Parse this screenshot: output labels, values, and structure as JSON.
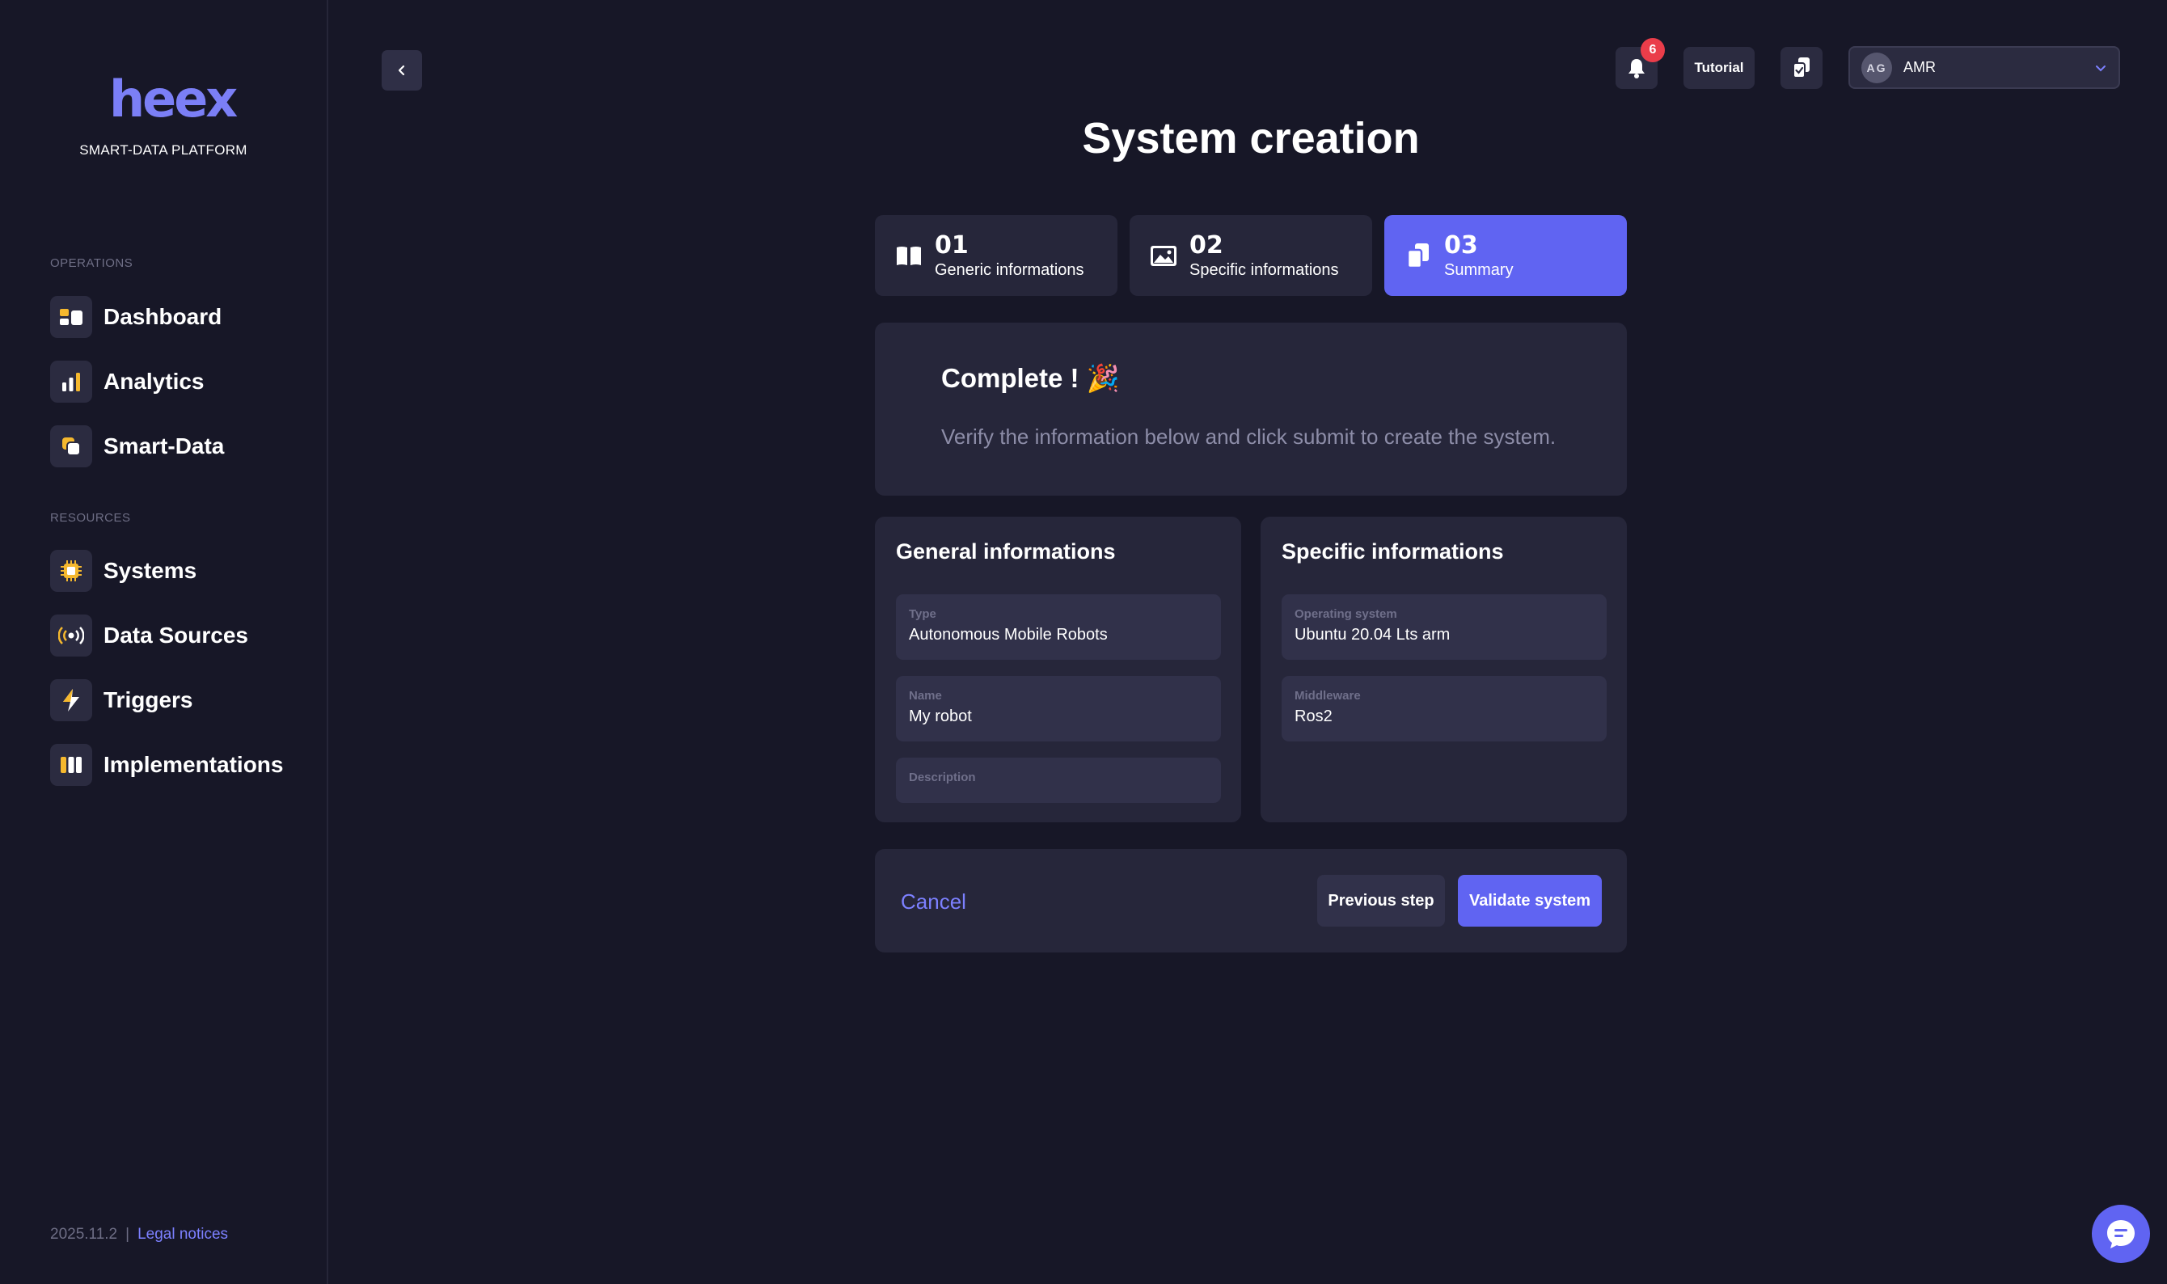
{
  "app": {
    "logo_text": "hee",
    "logo_x": "x",
    "tagline": "SMART-DATA PLATFORM"
  },
  "sidebar": {
    "sections": [
      {
        "label": "OPERATIONS",
        "items": [
          {
            "label": "Dashboard",
            "icon": "dashboard-icon"
          },
          {
            "label": "Analytics",
            "icon": "bar-chart-icon"
          },
          {
            "label": "Smart-Data",
            "icon": "smart-data-icon"
          }
        ]
      },
      {
        "label": "RESOURCES",
        "items": [
          {
            "label": "Systems",
            "icon": "chip-icon"
          },
          {
            "label": "Data Sources",
            "icon": "broadcast-icon"
          },
          {
            "label": "Triggers",
            "icon": "lightning-icon"
          },
          {
            "label": "Implementations",
            "icon": "columns-icon"
          }
        ]
      }
    ],
    "footer": {
      "version": "2025.11.2",
      "separator": "|",
      "legal": "Legal notices"
    }
  },
  "topbar": {
    "notification_count": "6",
    "tutorial_label": "Tutorial",
    "user": {
      "initials": "AG",
      "name": "AMR"
    }
  },
  "page": {
    "title": "System creation",
    "steps": [
      {
        "number": "01",
        "label": "Generic informations",
        "icon": "book-icon",
        "active": false
      },
      {
        "number": "02",
        "label": "Specific informations",
        "icon": "image-icon",
        "active": false
      },
      {
        "number": "03",
        "label": "Summary",
        "icon": "copy-docs-icon",
        "active": true
      }
    ],
    "complete": {
      "title": "Complete ! 🎉",
      "text": "Verify the information below and click submit to create the system."
    },
    "general": {
      "title": "General informations",
      "fields": [
        {
          "label": "Type",
          "value": "Autonomous Mobile Robots"
        },
        {
          "label": "Name",
          "value": "My robot"
        },
        {
          "label": "Description",
          "value": ""
        }
      ]
    },
    "specific": {
      "title": "Specific informations",
      "fields": [
        {
          "label": "Operating system",
          "value": "Ubuntu 20.04 Lts arm"
        },
        {
          "label": "Middleware",
          "value": "Ros2"
        }
      ]
    },
    "actions": {
      "cancel": "Cancel",
      "previous": "Previous step",
      "validate": "Validate system"
    }
  },
  "colors": {
    "background": "#171727",
    "card": "#26263a",
    "accent": "#6064f2",
    "link": "#7c80ff",
    "badge": "#ea3d4a",
    "icon_yellow": "#f5b82e"
  }
}
